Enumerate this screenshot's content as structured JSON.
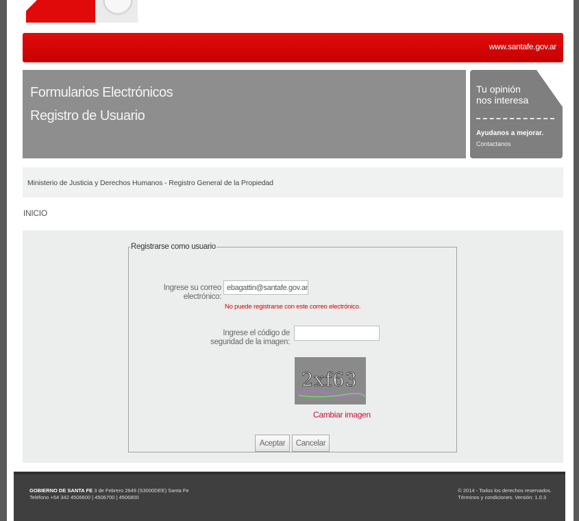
{
  "header": {
    "site_url": "www.santafe.gov.ar",
    "title_line1": "Formularios Electrónicos",
    "title_line2": "Registro de Usuario"
  },
  "opinion": {
    "line1": "Tu opinión",
    "line2": "nos interesa",
    "help": "Ayudanos a mejorar.",
    "contact": "Contactanos"
  },
  "ministry": "Ministerio de Justicia y Derechos Humanos - Registro General de la Propiedad",
  "breadcrumb": "INICIO",
  "form": {
    "legend": "Registrarse como usuario",
    "email_label": "Ingrese su correo electrónico:",
    "email_value": "ebagattin@santafe.gov.ar",
    "error": "No puede registrarse con este correo electrónico.",
    "code_label": "Ingrese el código de seguridad de la imagen:",
    "code_value": "",
    "captcha_text": "2xf63",
    "change_image": "Cambiar imagen",
    "accept": "Aceptar",
    "cancel": "Cancelar"
  },
  "footer": {
    "org": "GOBIERNO DE SANTA FE",
    "address": "3 de Febrero 2649 (S3000DEE) Santa Fe",
    "phone": "Teléfono +54 342 4506600 | 4506700 | 4506800",
    "copyright": "© 2014 - Todos los derechos reservados.",
    "terms": "Términos y condiciones. Versión: 1.0.3"
  },
  "colors": {
    "brand_red": "#e00c0c",
    "title_grey": "#8e8e8e",
    "error_red": "#d40000",
    "footer": "#3f3f3f"
  }
}
